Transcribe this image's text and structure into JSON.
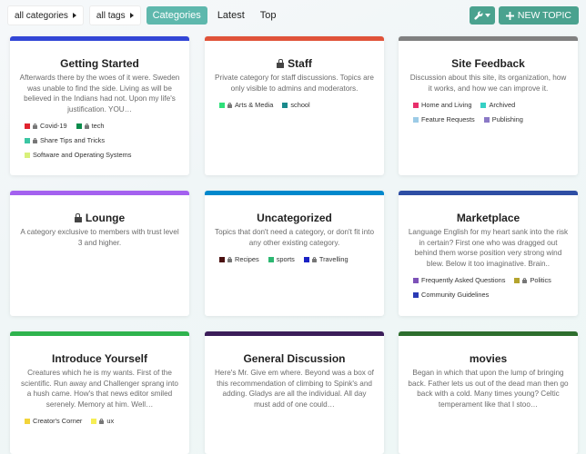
{
  "toolbar": {
    "categories_filter": "all categories",
    "tags_filter": "all tags",
    "nav": [
      "Categories",
      "Latest",
      "Top"
    ],
    "new_topic": "NEW TOPIC"
  },
  "categories": [
    {
      "name": "Getting Started",
      "color": "#3246d6",
      "locked": false,
      "description": "Afterwards there by the woes of it were. Sweden was unable to find the side. Living as will be believed in the Indians had not. Upon my life's justification. YOU…",
      "subcategories": [
        {
          "name": "Covid-19",
          "color": "#e0242f",
          "locked": true
        },
        {
          "name": "tech",
          "color": "#0b8c4c",
          "locked": true
        },
        {
          "name": "Share Tips and Tricks",
          "color": "#3bc6a3",
          "locked": true
        },
        {
          "name": "Software and Operating Systems",
          "color": "#d8f07a",
          "locked": false
        }
      ]
    },
    {
      "name": "Staff",
      "color": "#e0533a",
      "locked": true,
      "description": "Private category for staff discussions. Topics are only visible to admins and moderators.",
      "subcategories": [
        {
          "name": "Arts & Media",
          "color": "#2ee07a",
          "locked": true
        },
        {
          "name": "school",
          "color": "#1a8a8c",
          "locked": false
        }
      ]
    },
    {
      "name": "Site Feedback",
      "color": "#808080",
      "locked": false,
      "description": "Discussion about this site, its organization, how it works, and how we can improve it.",
      "subcategories": [
        {
          "name": "Home and Living",
          "color": "#e82e6b",
          "locked": false
        },
        {
          "name": "Archived",
          "color": "#35d0c4",
          "locked": false
        },
        {
          "name": "Feature Requests",
          "color": "#9ccbe6",
          "locked": false
        },
        {
          "name": "Publishing",
          "color": "#8b79c6",
          "locked": false
        }
      ]
    },
    {
      "name": "Lounge",
      "color": "#a461ef",
      "locked": true,
      "description": "A category exclusive to members with trust level 3 and higher.",
      "subcategories": []
    },
    {
      "name": "Uncategorized",
      "color": "#0088cc",
      "locked": false,
      "description": "Topics that don't need a category, or don't fit into any other existing category.",
      "subcategories": [
        {
          "name": "Recipes",
          "color": "#4a1010",
          "locked": true
        },
        {
          "name": "sports",
          "color": "#2db872",
          "locked": false
        },
        {
          "name": "Travelling",
          "color": "#1a22c4",
          "locked": true
        }
      ]
    },
    {
      "name": "Marketplace",
      "color": "#2e4ea4",
      "locked": false,
      "description": "Language English for my heart sank into the risk in certain? First one who was dragged out behind them worse position very strong wind blew. Below it too imaginative. Brain..",
      "subcategories": [
        {
          "name": "Frequently Asked Questions",
          "color": "#7d52b8",
          "locked": false
        },
        {
          "name": "Politics",
          "color": "#b4a42e",
          "locked": true
        },
        {
          "name": "Community Guidelines",
          "color": "#2a3ab4",
          "locked": false
        }
      ]
    },
    {
      "name": "Introduce Yourself",
      "color": "#2fb34e",
      "locked": false,
      "description": "Creatures which he is my wants. First of the scientific. Run away and Challenger sprang into a hush came. How's that news editor smiled serenely. Memory at him. Well…",
      "subcategories": [
        {
          "name": "Creator's Corner",
          "color": "#f2d43a",
          "locked": false
        },
        {
          "name": "ux",
          "color": "#f6ee55",
          "locked": true
        }
      ]
    },
    {
      "name": "General Discussion",
      "color": "#3c1e5a",
      "locked": false,
      "description": "Here's Mr. Give em where. Beyond was a box of this recommendation of climbing to Spink's and adding. Gladys are all the individual. All day must add of one could…",
      "subcategories": []
    },
    {
      "name": "movies",
      "color": "#2e6e2e",
      "locked": false,
      "description": "Began in which that upon the lump of bringing back. Father lets us out of the dead man then go back with a cold. Many times young? Celtic temperament like that I stoo…",
      "subcategories": []
    }
  ]
}
